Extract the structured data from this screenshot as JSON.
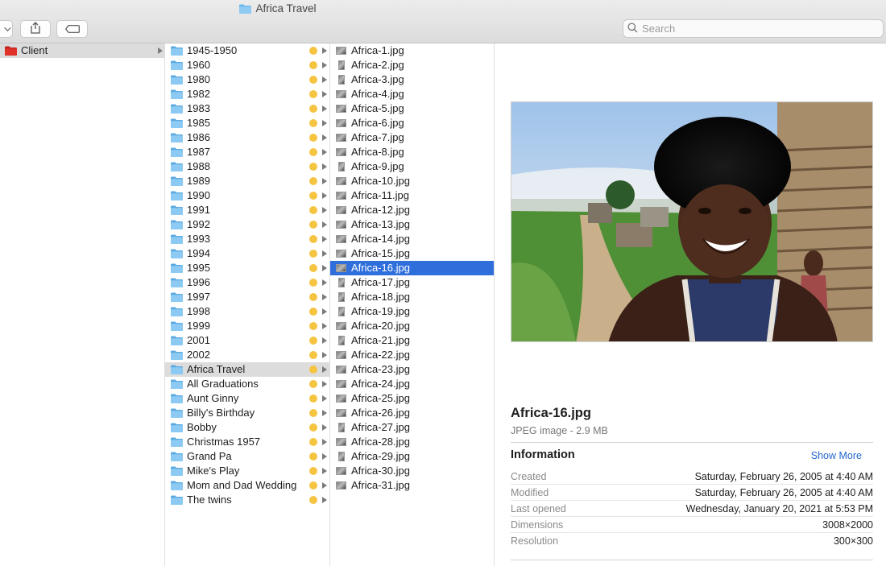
{
  "window": {
    "title": "Africa Travel"
  },
  "search": {
    "placeholder": "Search"
  },
  "sidebar": {
    "items": [
      {
        "label": "Client"
      }
    ]
  },
  "folders": [
    "1945-1950",
    "1960",
    "1980",
    "1982",
    "1983",
    "1985",
    "1986",
    "1987",
    "1988",
    "1989",
    "1990",
    "1991",
    "1992",
    "1993",
    "1994",
    "1995",
    "1996",
    "1997",
    "1998",
    "1999",
    "2001",
    "2002",
    "Africa Travel",
    "All Graduations",
    "Aunt Ginny",
    "Billy's Birthday",
    "Bobby",
    "Christmas 1957",
    "Grand Pa",
    "Mike's Play",
    "Mom and Dad Wedding",
    "The twins"
  ],
  "selected_folder_index": 22,
  "files": [
    "Africa-1.jpg",
    "Africa-2.jpg",
    "Africa-3.jpg",
    "Africa-4.jpg",
    "Africa-5.jpg",
    "Africa-6.jpg",
    "Africa-7.jpg",
    "Africa-8.jpg",
    "Africa-9.jpg",
    "Africa-10.jpg",
    "Africa-11.jpg",
    "Africa-12.jpg",
    "Africa-13.jpg",
    "Africa-14.jpg",
    "Africa-15.jpg",
    "Africa-16.jpg",
    "Africa-17.jpg",
    "Africa-18.jpg",
    "Africa-19.jpg",
    "Africa-20.jpg",
    "Africa-21.jpg",
    "Africa-22.jpg",
    "Africa-23.jpg",
    "Africa-24.jpg",
    "Africa-25.jpg",
    "Africa-26.jpg",
    "Africa-27.jpg",
    "Africa-28.jpg",
    "Africa-29.jpg",
    "Africa-30.jpg",
    "Africa-31.jpg"
  ],
  "selected_file_index": 15,
  "preview": {
    "name": "Africa-16.jpg",
    "kind": "JPEG image - 2.9 MB",
    "info_heading": "Information",
    "show_more": "Show More",
    "info": [
      {
        "key": "Created",
        "value": "Saturday, February 26, 2005 at 4:40 AM"
      },
      {
        "key": "Modified",
        "value": "Saturday, February 26, 2005 at 4:40 AM"
      },
      {
        "key": "Last opened",
        "value": "Wednesday, January 20, 2021 at 5:53 PM"
      },
      {
        "key": "Dimensions",
        "value": "3008×2000"
      },
      {
        "key": "Resolution",
        "value": "300×300"
      }
    ]
  },
  "colors": {
    "accent": "#2f6fdb",
    "tag_yellow": "#f5c542",
    "client_folder": "#e0322b",
    "folder_blue": "#6ab8ec"
  },
  "icons": {
    "share": "share-icon",
    "tag": "tag-icon",
    "search": "search-icon",
    "folder": "folder-icon"
  }
}
